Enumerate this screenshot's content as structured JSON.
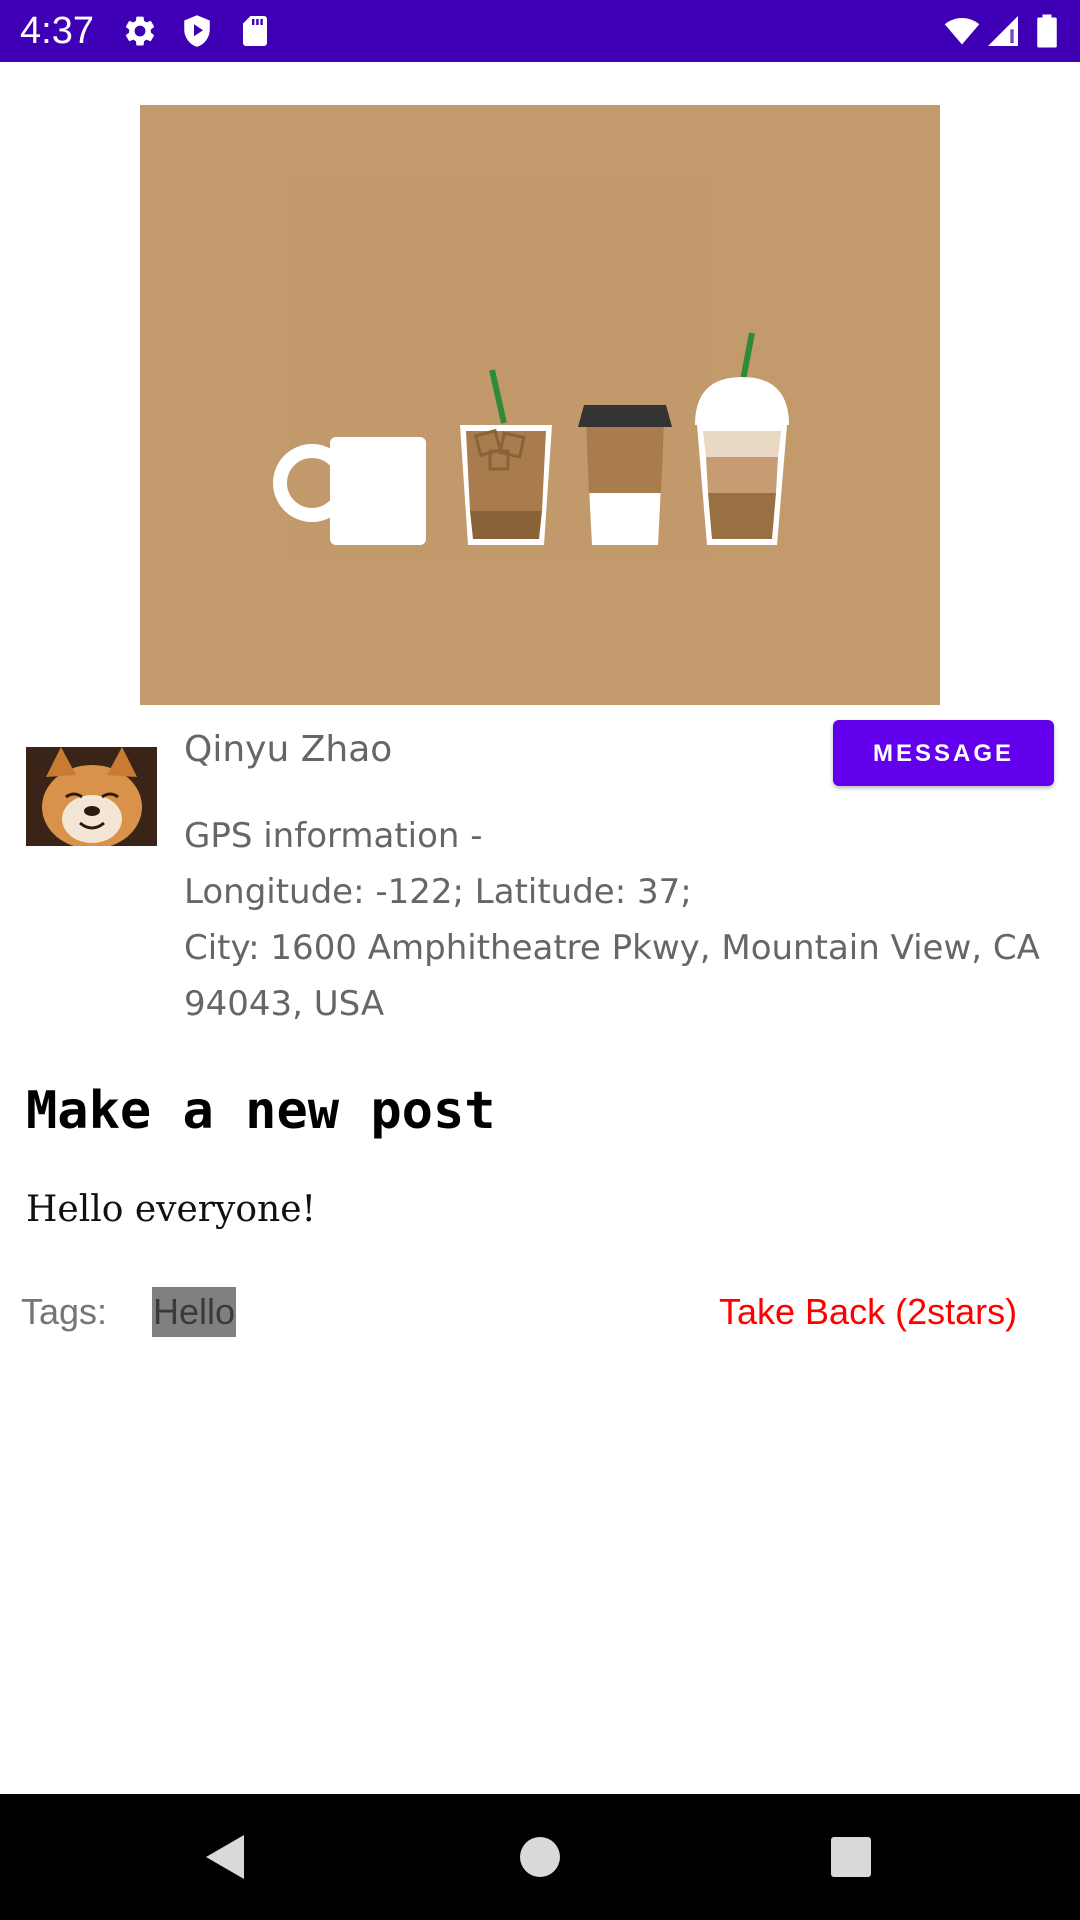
{
  "status_bar": {
    "time": "4:37",
    "background_color": "#3f00b5",
    "left_icons": [
      "settings-gear-icon",
      "play-protect-icon",
      "sd-card-icon"
    ],
    "right_icons": [
      "wifi-icon",
      "cell-signal-icon",
      "battery-icon"
    ]
  },
  "hero_image": {
    "description_icon": "coffee-cups-illustration",
    "background_color": "#c39a6b"
  },
  "author": {
    "name": "Qinyu Zhao",
    "avatar_icon": "shiba-dog-avatar"
  },
  "message_button": {
    "label": "MESSAGE",
    "color": "#6200ee"
  },
  "gps": {
    "line1": "GPS information -",
    "line2": "Longitude: -122; Latitude: 37;",
    "line3": "City: 1600 Amphitheatre Pkwy, Mountain View, CA",
    "line4": "94043, USA"
  },
  "post": {
    "heading": "Make a new post",
    "body": "Hello everyone!"
  },
  "tags": {
    "label": "Tags:",
    "items": [
      "Hello"
    ]
  },
  "take_back": {
    "label": "Take Back (2stars)",
    "color": "#ff0000"
  },
  "nav_bar": {
    "buttons": [
      "back-icon",
      "home-icon",
      "recents-icon"
    ]
  }
}
